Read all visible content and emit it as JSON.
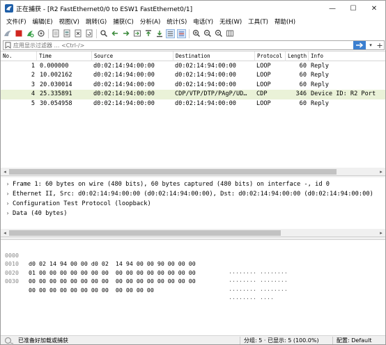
{
  "window": {
    "title": "正在捕获 - [R2 FastEthernet0/0 to ESW1 FastEthernet0/1]",
    "minimize": "—",
    "maximize": "☐",
    "close": "✕"
  },
  "menu": [
    "文件(F)",
    "编辑(E)",
    "视图(V)",
    "跳转(G)",
    "捕获(C)",
    "分析(A)",
    "统计(S)",
    "电话(Y)",
    "无线(W)",
    "工具(T)",
    "帮助(H)"
  ],
  "toolbar": {
    "icons": [
      "shark-fin-icon",
      "stop-icon",
      "restart-icon",
      "capture-options-icon",
      "open-file-icon",
      "save-file-icon",
      "close-file-icon",
      "reload-icon",
      "find-packet-icon",
      "go-back-icon",
      "go-forward-icon",
      "go-to-packet-icon",
      "go-first-icon",
      "go-last-icon",
      "autoscroll-icon",
      "colorize-icon",
      "zoom-in-icon",
      "zoom-out-icon",
      "zoom-normal-icon",
      "resize-columns-icon"
    ]
  },
  "filter": {
    "placeholder": "应用显示过滤器 … <Ctrl-/>",
    "apply_icon": "arrow-right-icon",
    "add_icon": "plus-icon"
  },
  "packet_list": {
    "columns": [
      "No.",
      "Time",
      "Source",
      "Destination",
      "Protocol",
      "Length",
      "Info"
    ],
    "rows": [
      {
        "no": "1",
        "time": "0.000000",
        "src": "d0:02:14:94:00:00",
        "dst": "d0:02:14:94:00:00",
        "proto": "LOOP",
        "len": "60",
        "info": "Reply",
        "bg": "#ffffff"
      },
      {
        "no": "2",
        "time": "10.002162",
        "src": "d0:02:14:94:00:00",
        "dst": "d0:02:14:94:00:00",
        "proto": "LOOP",
        "len": "60",
        "info": "Reply",
        "bg": "#ffffff"
      },
      {
        "no": "3",
        "time": "20.030014",
        "src": "d0:02:14:94:00:00",
        "dst": "d0:02:14:94:00:00",
        "proto": "LOOP",
        "len": "60",
        "info": "Reply",
        "bg": "#ffffff"
      },
      {
        "no": "4",
        "time": "25.335891",
        "src": "d0:02:14:94:00:00",
        "dst": "CDP/VTP/DTP/PAgP/UD…",
        "proto": "CDP",
        "len": "346",
        "info": "Device ID: R2  Port",
        "bg": "#eaf2d8"
      },
      {
        "no": "5",
        "time": "30.054958",
        "src": "d0:02:14:94:00:00",
        "dst": "d0:02:14:94:00:00",
        "proto": "LOOP",
        "len": "60",
        "info": "Reply",
        "bg": "#ffffff"
      }
    ]
  },
  "details": [
    "Frame 1: 60 bytes on wire (480 bits), 60 bytes captured (480 bits) on interface -, id 0",
    "Ethernet II, Src: d0:02:14:94:00:00 (d0:02:14:94:00:00), Dst: d0:02:14:94:00:00 (d0:02:14:94:00:00)",
    "Configuration Test Protocol (loopback)",
    "Data (40 bytes)"
  ],
  "bytes": [
    {
      "offset": "0000",
      "hex": "d0 02 14 94 00 00 d0 02  14 94 00 00 90 00 00 00",
      "ascii": "········ ········"
    },
    {
      "offset": "0010",
      "hex": "01 00 00 00 00 00 00 00  00 00 00 00 00 00 00 00",
      "ascii": "········ ········"
    },
    {
      "offset": "0020",
      "hex": "00 00 00 00 00 00 00 00  00 00 00 00 00 00 00 00",
      "ascii": "········ ········"
    },
    {
      "offset": "0030",
      "hex": "00 00 00 00 00 00 00 00  00 00 00 00",
      "ascii": "········ ····"
    }
  ],
  "status": {
    "ready": "已准备好加载或捕获",
    "stats": "分组: 5 · 已显示: 5 (100.0%)",
    "profile": "配置: Default"
  },
  "colors": {
    "cdp_row": "#eaf2d8",
    "accent": "#3b7fd0"
  }
}
